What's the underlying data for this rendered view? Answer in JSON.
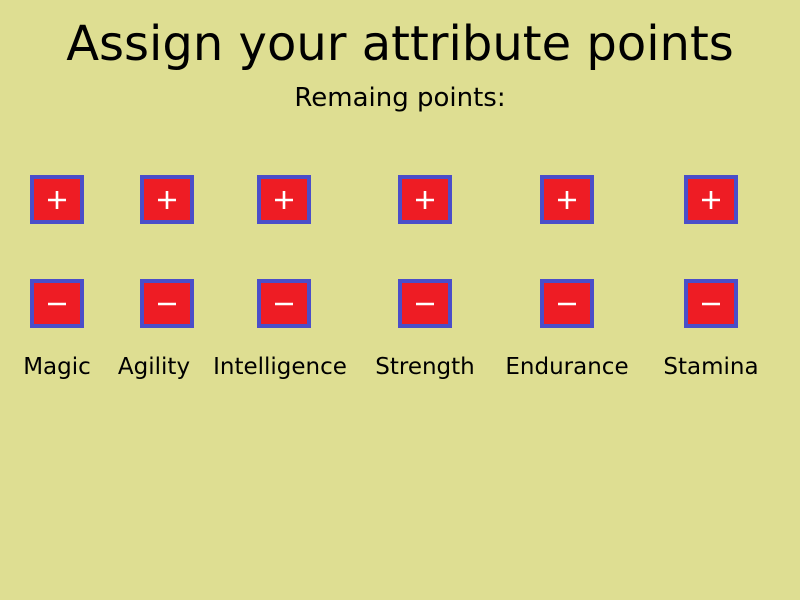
{
  "title": "Assign your attribute points",
  "remaining_label": "Remaing points:",
  "colors": {
    "background": "#dede92",
    "button_fill": "#ee1c24",
    "button_border": "#4a4ec9",
    "button_glyph": "#ffffff"
  },
  "attributes": [
    {
      "label": "Magic",
      "increase_icon": "plus-icon",
      "decrease_icon": "minus-icon"
    },
    {
      "label": "Agility",
      "increase_icon": "plus-icon",
      "decrease_icon": "minus-icon"
    },
    {
      "label": "Intelligence",
      "increase_icon": "plus-icon",
      "decrease_icon": "minus-icon"
    },
    {
      "label": "Strength",
      "increase_icon": "plus-icon",
      "decrease_icon": "minus-icon"
    },
    {
      "label": "Endurance",
      "increase_icon": "plus-icon",
      "decrease_icon": "minus-icon"
    },
    {
      "label": "Stamina",
      "increase_icon": "plus-icon",
      "decrease_icon": "minus-icon"
    }
  ]
}
